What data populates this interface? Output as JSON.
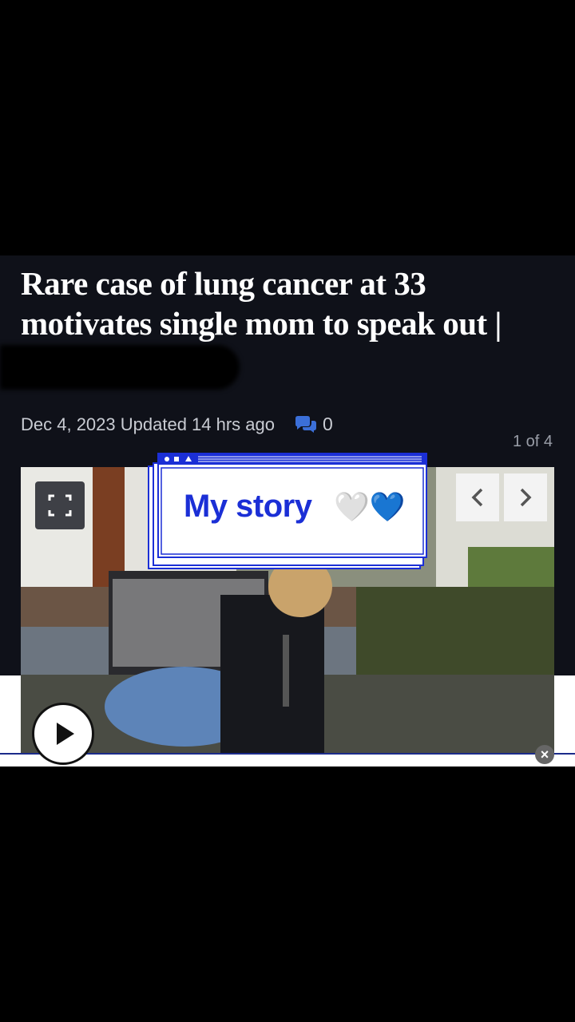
{
  "article": {
    "headline": "Rare case of lung cancer at 33 motivates single mom to speak out |",
    "date": "Dec 4, 2023 Updated 14 hrs ago",
    "comment_count": "0",
    "gallery_counter": "1 of 4"
  },
  "overlay": {
    "story_label": "My story",
    "hearts": "🤍💙"
  },
  "colors": {
    "article_bg": "#0f1119",
    "story_blue": "#1b2fd6"
  }
}
